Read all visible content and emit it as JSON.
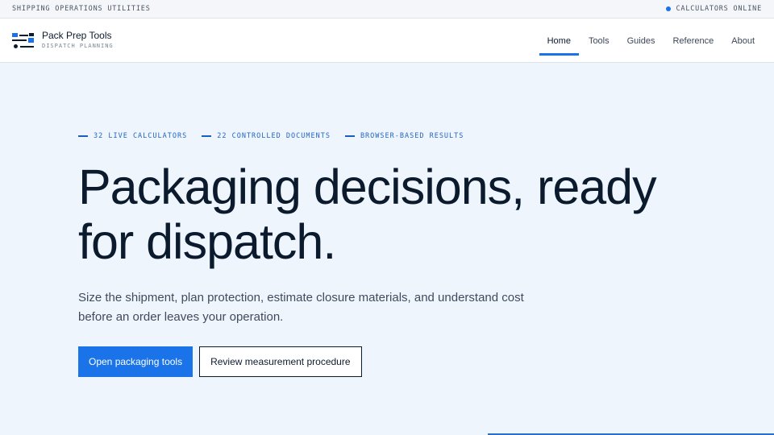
{
  "topbar": {
    "left_text": "SHIPPING OPERATIONS UTILITIES",
    "status_text": "CALCULATORS ONLINE",
    "status_color": "#1a73e8"
  },
  "brand": {
    "title": "Pack Prep Tools",
    "subtitle": "DISPATCH PLANNING",
    "logo_icon": "logo-icon"
  },
  "nav": {
    "items": [
      {
        "label": "Home",
        "active": true
      },
      {
        "label": "Tools",
        "active": false
      },
      {
        "label": "Guides",
        "active": false
      },
      {
        "label": "Reference",
        "active": false
      },
      {
        "label": "About",
        "active": false
      }
    ]
  },
  "hero": {
    "tags": [
      "32 LIVE CALCULATORS",
      "22 CONTROLLED DOCUMENTS",
      "BROWSER-BASED RESULTS"
    ],
    "headline": "Packaging decisions, ready for dispatch.",
    "description": "Size the shipment, plan protection, estimate closure materials, and understand cost before an order leaves your operation.",
    "primary_button": "Open packaging tools",
    "secondary_button": "Review measurement procedure"
  },
  "colors": {
    "accent": "#1a73e8",
    "background": "#eef5fd",
    "text": "#0b1a2d"
  }
}
